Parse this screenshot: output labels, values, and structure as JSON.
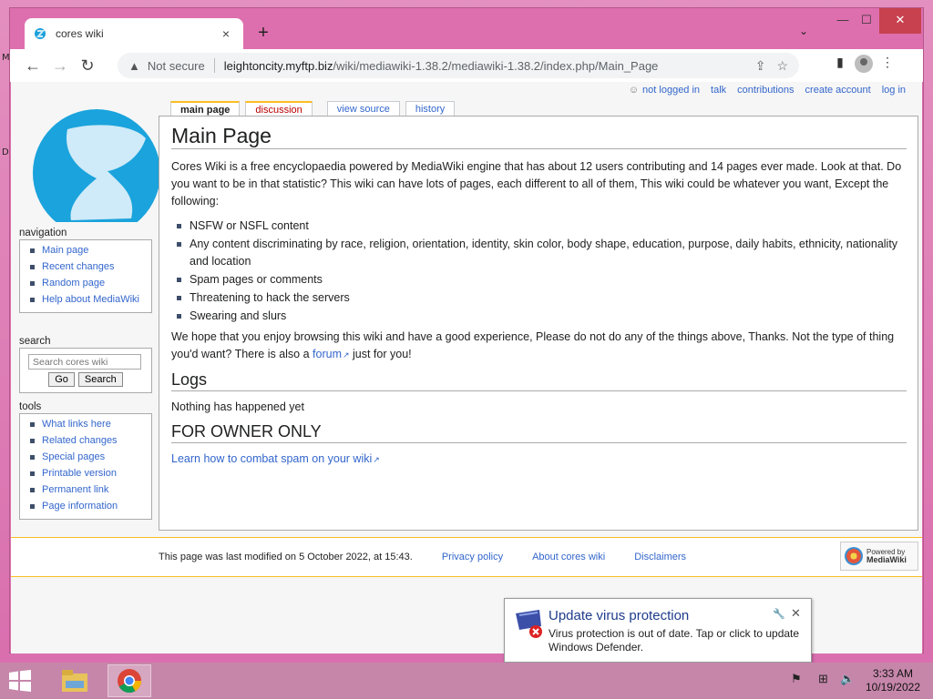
{
  "desktop": {
    "edge_letters": [
      "M",
      "D"
    ]
  },
  "browser": {
    "tab_title": "cores wiki",
    "tab_close": "×",
    "new_tab": "+",
    "tab_search": "⌄",
    "window_controls": {
      "minimize": "—",
      "maximize": "☐",
      "close": "✕"
    },
    "nav": {
      "back": "←",
      "forward": "→",
      "reload": "↻"
    },
    "omnibox": {
      "security_label": "Not secure",
      "url_host": "leightoncity.myftp.biz",
      "url_path": "/wiki/mediawiki-1.38.2/mediawiki-1.38.2/index.php/Main_Page"
    }
  },
  "wiki": {
    "personal_tools": [
      "not logged in",
      "talk",
      "contributions",
      "create account",
      "log in"
    ],
    "page_tabs": [
      "main page",
      "discussion",
      "view source",
      "history"
    ],
    "title": "Main Page",
    "intro": "Cores Wiki is a free encyclopaedia powered by MediaWiki engine that has about 12 users contributing and 14 pages ever made. Look at that. Do you want to be in that statistic? This wiki can have lots of pages, each different to all of them, This wiki could be whatever you want, Except the following:",
    "rules": [
      "NSFW or NSFL content",
      "Any content discriminating by race, religion, orientation, identity, skin color, body shape, education, purpose, daily habits, ethnicity, nationality and location",
      "Spam pages or comments",
      "Threatening to hack the servers",
      "Swearing and slurs"
    ],
    "outro_before": "We hope that you enjoy browsing this wiki and have a good experience, Please do not do any of the things above, Thanks. Not the type of thing you'd want? There is also a ",
    "outro_link": "forum",
    "outro_after": " just for you!",
    "logs_heading": "Logs",
    "logs_text": "Nothing has happened yet",
    "owner_heading": "FOR OWNER ONLY",
    "owner_link": "Learn how to combat spam on your wiki",
    "sidebar": {
      "navigation_title": "navigation",
      "navigation": [
        "Main page",
        "Recent changes",
        "Random page",
        "Help about MediaWiki"
      ],
      "search_title": "search",
      "search_placeholder": "Search cores wiki",
      "go_label": "Go",
      "search_label": "Search",
      "tools_title": "tools",
      "tools": [
        "What links here",
        "Related changes",
        "Special pages",
        "Printable version",
        "Permanent link",
        "Page information"
      ]
    },
    "footer": {
      "last_modified": "This page was last modified on 5 October 2022, at 15:43.",
      "links": [
        "Privacy policy",
        "About cores wiki",
        "Disclaimers"
      ],
      "powered_line1": "Powered by",
      "powered_line2": "MediaWiki"
    }
  },
  "notification": {
    "title": "Update virus protection",
    "message": "Virus protection is out of date. Tap or click to update Windows Defender.",
    "close": "✕",
    "settings_icon": "🔧"
  },
  "taskbar": {
    "time": "3:33 AM",
    "date": "10/19/2022"
  },
  "colors": {
    "link": "#3366cc",
    "talk_red": "#ba0000",
    "tab_accent": "#fabd23",
    "desktop_pink": "#de6fae",
    "taskbar": "#c686aa"
  }
}
